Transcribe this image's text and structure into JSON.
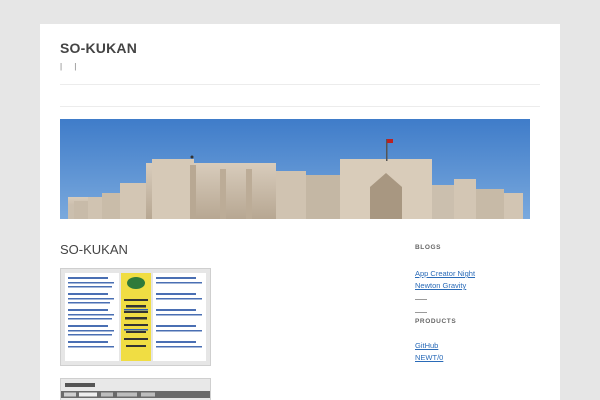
{
  "site": {
    "title": "SO-KUKAN",
    "description": "| |"
  },
  "entry": {
    "title": "SO-KUKAN"
  },
  "sidebar": {
    "blogs_title": "BLOGS",
    "blogs": [
      "App Creator Night",
      "Newton Gravity"
    ],
    "products_title": "PRODUCTS",
    "products": [
      "GitHub",
      "NEWT/0"
    ]
  },
  "colors": {
    "background": "#e6e6e6",
    "link": "#2a6bb8",
    "sky": "#4b86cf"
  },
  "icons": {
    "header_image": "caravanserai-photo",
    "thumbnail_1": "website-screenshot",
    "thumbnail_2": "app-screenshot"
  }
}
